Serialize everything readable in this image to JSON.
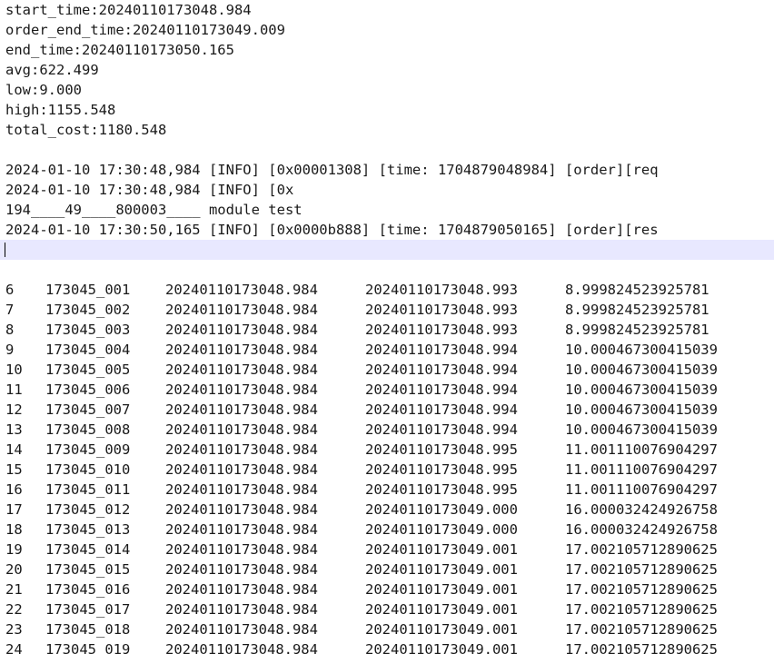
{
  "summary": [
    "start_time:20240110173048.984",
    "order_end_time:20240110173049.009",
    "end_time:20240110173050.165",
    "avg:622.499",
    "low:9.000",
    "high:1155.548",
    "total_cost:1180.548"
  ],
  "log_lines": [
    "2024-01-10 17:30:48,984 [INFO] [0x00001308] [time: 1704879048984] [order][req",
    "2024-01-10 17:30:48,984 [INFO] [0x",
    "194____49____800003____ module test",
    "2024-01-10 17:30:50,165 [INFO] [0x0000b888] [time: 1704879050165] [order][res"
  ],
  "rows": [
    [
      "6",
      "173045_001",
      "20240110173048.984",
      "20240110173048.993",
      "8.999824523925781"
    ],
    [
      "7",
      "173045_002",
      "20240110173048.984",
      "20240110173048.993",
      "8.999824523925781"
    ],
    [
      "8",
      "173045_003",
      "20240110173048.984",
      "20240110173048.993",
      "8.999824523925781"
    ],
    [
      "9",
      "173045_004",
      "20240110173048.984",
      "20240110173048.994",
      "10.000467300415039"
    ],
    [
      "10",
      "173045_005",
      "20240110173048.984",
      "20240110173048.994",
      "10.000467300415039"
    ],
    [
      "11",
      "173045_006",
      "20240110173048.984",
      "20240110173048.994",
      "10.000467300415039"
    ],
    [
      "12",
      "173045_007",
      "20240110173048.984",
      "20240110173048.994",
      "10.000467300415039"
    ],
    [
      "13",
      "173045_008",
      "20240110173048.984",
      "20240110173048.994",
      "10.000467300415039"
    ],
    [
      "14",
      "173045_009",
      "20240110173048.984",
      "20240110173048.995",
      "11.001110076904297"
    ],
    [
      "15",
      "173045_010",
      "20240110173048.984",
      "20240110173048.995",
      "11.001110076904297"
    ],
    [
      "16",
      "173045_011",
      "20240110173048.984",
      "20240110173048.995",
      "11.001110076904297"
    ],
    [
      "17",
      "173045_012",
      "20240110173048.984",
      "20240110173049.000",
      "16.000032424926758"
    ],
    [
      "18",
      "173045_013",
      "20240110173048.984",
      "20240110173049.000",
      "16.000032424926758"
    ],
    [
      "19",
      "173045_014",
      "20240110173048.984",
      "20240110173049.001",
      "17.002105712890625"
    ],
    [
      "20",
      "173045_015",
      "20240110173048.984",
      "20240110173049.001",
      "17.002105712890625"
    ],
    [
      "21",
      "173045_016",
      "20240110173048.984",
      "20240110173049.001",
      "17.002105712890625"
    ],
    [
      "22",
      "173045_017",
      "20240110173048.984",
      "20240110173049.001",
      "17.002105712890625"
    ],
    [
      "23",
      "173045_018",
      "20240110173048.984",
      "20240110173049.001",
      "17.002105712890625"
    ],
    [
      "24",
      "173045_019",
      "20240110173048.984",
      "20240110173049.001",
      "17.002105712890625"
    ]
  ],
  "colors": {
    "active_line": "#e8e8ff",
    "text": "#1a1a1a"
  }
}
